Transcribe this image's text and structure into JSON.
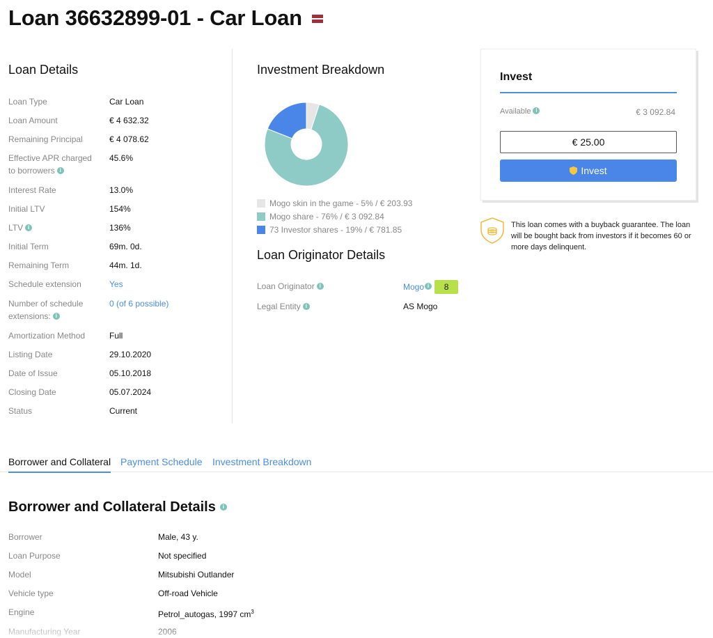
{
  "page": {
    "title": "Loan 36632899-01 - Car Loan",
    "flag_colors": [
      "#9e3039",
      "#ffffff",
      "#9e3039"
    ]
  },
  "loan_details": {
    "title": "Loan Details",
    "rows": [
      {
        "label": "Loan Type",
        "value": "Car Loan"
      },
      {
        "label": "Loan Amount",
        "value": "€ 4 632.32"
      },
      {
        "label": "Remaining Principal",
        "value": "€ 4 078.62"
      },
      {
        "label": "Effective APR charged",
        "label2": "to borrowers",
        "value": "45.6%",
        "info": true
      },
      {
        "label": "Interest Rate",
        "value": "13.0%"
      },
      {
        "label": "Initial LTV",
        "value": "154%"
      },
      {
        "label": "LTV",
        "value": "136%",
        "info": true
      },
      {
        "label": "Initial Term",
        "value": "69m. 0d."
      },
      {
        "label": "Remaining Term",
        "value": "44m. 1d."
      },
      {
        "label": "Schedule extension",
        "value": "Yes",
        "link": true
      },
      {
        "label": "Number of schedule",
        "label2": "extensions:",
        "value": "0 (of 6 possible)",
        "link": true,
        "info": true
      },
      {
        "label": "Amortization Method",
        "value": "Full"
      },
      {
        "label": "Listing Date",
        "value": "29.10.2020"
      },
      {
        "label": "Date of Issue",
        "value": "05.10.2018"
      },
      {
        "label": "Closing Date",
        "value": "05.07.2024"
      },
      {
        "label": "Status",
        "value": "Current"
      }
    ]
  },
  "investment_breakdown": {
    "title": "Investment Breakdown",
    "legend": [
      {
        "label": "Mogo skin in the game - 5% / € 203.93",
        "color": "#e6e6e6",
        "percent": 5
      },
      {
        "label": "Mogo share - 76% / € 3 092.84",
        "color": "#8ecac6",
        "percent": 76
      },
      {
        "label": "73 Investor shares - 19% / € 781.85",
        "color": "#4a86e8",
        "percent": 19
      }
    ]
  },
  "originator": {
    "title": "Loan Originator Details",
    "loan_originator_label": "Loan Originator",
    "loan_originator_value": "Mogo",
    "rating": "8",
    "legal_entity_label": "Legal Entity",
    "legal_entity_value": "AS Mogo"
  },
  "invest": {
    "title": "Invest",
    "available_label": "Available",
    "available_value": "€ 3 092.84",
    "amount_value": "€ 25.00",
    "button_label": "Invest",
    "accent_color": "#4a86e8"
  },
  "buyback": {
    "text": "This loan comes with a buyback guarantee. The loan will be bought back from investors if it becomes 60 or more days delinquent."
  },
  "tabs": [
    {
      "label": "Borrower and Collateral",
      "active": true
    },
    {
      "label": "Payment Schedule",
      "active": false
    },
    {
      "label": "Investment Breakdown",
      "active": false
    }
  ],
  "borrower": {
    "title": "Borrower and Collateral Details",
    "rows": [
      {
        "label": "Borrower",
        "value": "Male, 43 y."
      },
      {
        "label": "Loan Purpose",
        "value": "Not specified"
      },
      {
        "label": "Model",
        "value": "Mitsubishi Outlander"
      },
      {
        "label": "Vehicle type",
        "value": "Off-road Vehicle"
      },
      {
        "label": "Engine",
        "value": "Petrol_autogas, 1997 cm",
        "sup": "3"
      },
      {
        "label": "Manufacturing Year",
        "value": "2006"
      }
    ]
  }
}
